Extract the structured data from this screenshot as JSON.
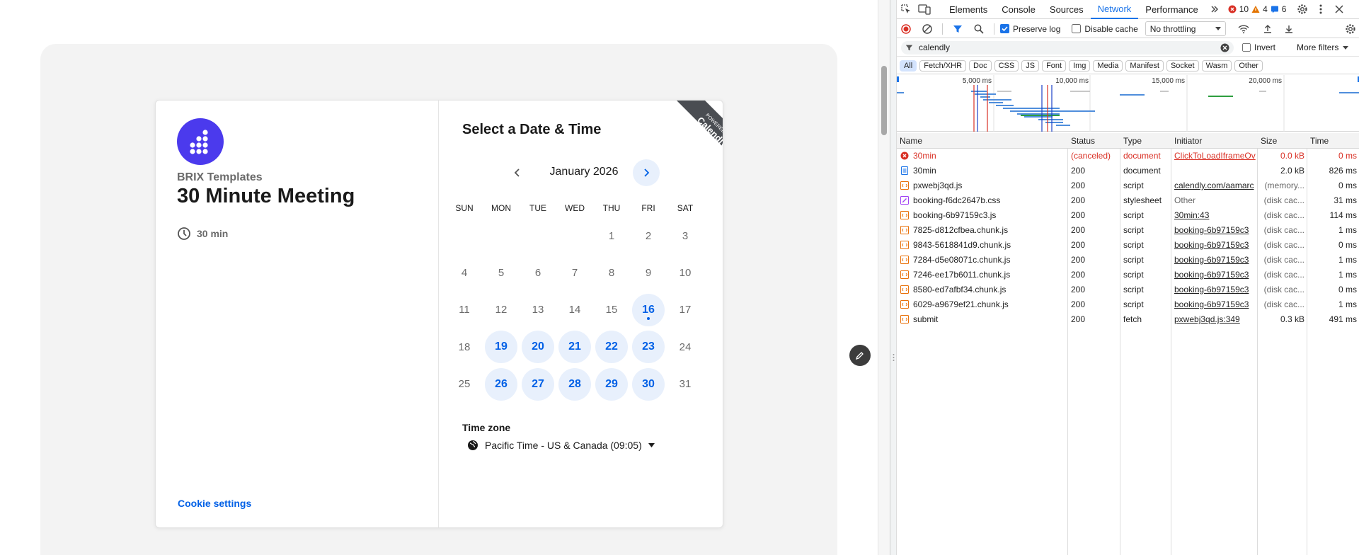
{
  "booking": {
    "org": "BRIX Templates",
    "meeting_title": "30 Minute Meeting",
    "duration": "30 min",
    "cookie_settings": "Cookie settings",
    "select_title": "Select a Date & Time",
    "ribbon_line1": "POWERED BY",
    "ribbon_line2": "Calendly",
    "month": "January 2026",
    "weekdays": [
      "SUN",
      "MON",
      "TUE",
      "WED",
      "THU",
      "FRI",
      "SAT"
    ],
    "days": [
      {
        "n": ""
      },
      {
        "n": ""
      },
      {
        "n": ""
      },
      {
        "n": ""
      },
      {
        "n": "1"
      },
      {
        "n": "2"
      },
      {
        "n": "3"
      },
      {
        "n": "4"
      },
      {
        "n": "5"
      },
      {
        "n": "6"
      },
      {
        "n": "7"
      },
      {
        "n": "8"
      },
      {
        "n": "9"
      },
      {
        "n": "10"
      },
      {
        "n": "11"
      },
      {
        "n": "12"
      },
      {
        "n": "13"
      },
      {
        "n": "14"
      },
      {
        "n": "15"
      },
      {
        "n": "16",
        "avail": true,
        "today": true
      },
      {
        "n": "17"
      },
      {
        "n": "18"
      },
      {
        "n": "19",
        "avail": true
      },
      {
        "n": "20",
        "avail": true
      },
      {
        "n": "21",
        "avail": true
      },
      {
        "n": "22",
        "avail": true
      },
      {
        "n": "23",
        "avail": true
      },
      {
        "n": "24"
      },
      {
        "n": "25"
      },
      {
        "n": "26",
        "avail": true
      },
      {
        "n": "27",
        "avail": true
      },
      {
        "n": "28",
        "avail": true
      },
      {
        "n": "29",
        "avail": true
      },
      {
        "n": "30",
        "avail": true
      },
      {
        "n": "31"
      }
    ],
    "timezone_label": "Time zone",
    "timezone_value": "Pacific Time - US & Canada (09:05)",
    "accent": "#0060e6",
    "logo_color": "#4b3aed"
  },
  "devtools": {
    "tabs": [
      "Elements",
      "Console",
      "Sources",
      "Network",
      "Performance"
    ],
    "active_tab": "Network",
    "errors": "10",
    "warnings": "4",
    "messages": "6",
    "preserve_log": "Preserve log",
    "disable_cache": "Disable cache",
    "throttling": "No throttling",
    "filter_value": "calendly",
    "invert": "Invert",
    "more_filters": "More filters",
    "types": [
      "All",
      "Fetch/XHR",
      "Doc",
      "CSS",
      "JS",
      "Font",
      "Img",
      "Media",
      "Manifest",
      "Socket",
      "Wasm",
      "Other"
    ],
    "timeline_ticks": [
      "5,000 ms",
      "10,000 ms",
      "15,000 ms",
      "20,000 ms"
    ],
    "columns": [
      "Name",
      "Status",
      "Type",
      "Initiator",
      "Size",
      "Time"
    ],
    "rows": [
      {
        "kind": "error",
        "name": "30min",
        "status": "(canceled)",
        "type": "document",
        "initiator": "ClickToLoadIframeOv",
        "size": "0.0 kB",
        "time": "0 ms"
      },
      {
        "kind": "doc",
        "name": "30min",
        "status": "200",
        "type": "document",
        "initiator": "",
        "size": "2.0 kB",
        "time": "826 ms"
      },
      {
        "kind": "script",
        "name": "pxwebj3qd.js",
        "status": "200",
        "type": "script",
        "initiator": "calendly.com/aamarc",
        "size": "(memory...",
        "time": "0 ms"
      },
      {
        "kind": "css",
        "name": "booking-f6dc2647b.css",
        "status": "200",
        "type": "stylesheet",
        "initiator": "Other",
        "size": "(disk cac...",
        "time": "31 ms"
      },
      {
        "kind": "script",
        "name": "booking-6b97159c3.js",
        "status": "200",
        "type": "script",
        "initiator": "30min:43",
        "size": "(disk cac...",
        "time": "114 ms"
      },
      {
        "kind": "script",
        "name": "7825-d812cfbea.chunk.js",
        "status": "200",
        "type": "script",
        "initiator": "booking-6b97159c3",
        "size": "(disk cac...",
        "time": "1 ms"
      },
      {
        "kind": "script",
        "name": "9843-5618841d9.chunk.js",
        "status": "200",
        "type": "script",
        "initiator": "booking-6b97159c3",
        "size": "(disk cac...",
        "time": "0 ms"
      },
      {
        "kind": "script",
        "name": "7284-d5e08071c.chunk.js",
        "status": "200",
        "type": "script",
        "initiator": "booking-6b97159c3",
        "size": "(disk cac...",
        "time": "1 ms"
      },
      {
        "kind": "script",
        "name": "7246-ee17b6011.chunk.js",
        "status": "200",
        "type": "script",
        "initiator": "booking-6b97159c3",
        "size": "(disk cac...",
        "time": "1 ms"
      },
      {
        "kind": "script",
        "name": "8580-ed7afbf34.chunk.js",
        "status": "200",
        "type": "script",
        "initiator": "booking-6b97159c3",
        "size": "(disk cac...",
        "time": "0 ms"
      },
      {
        "kind": "script",
        "name": "6029-a9679ef21.chunk.js",
        "status": "200",
        "type": "script",
        "initiator": "booking-6b97159c3",
        "size": "(disk cac...",
        "time": "1 ms"
      },
      {
        "kind": "fetch",
        "name": "submit",
        "status": "200",
        "type": "fetch",
        "initiator": "pxwebj3qd.js:349",
        "size": "0.3 kB",
        "time": "491 ms"
      }
    ]
  }
}
